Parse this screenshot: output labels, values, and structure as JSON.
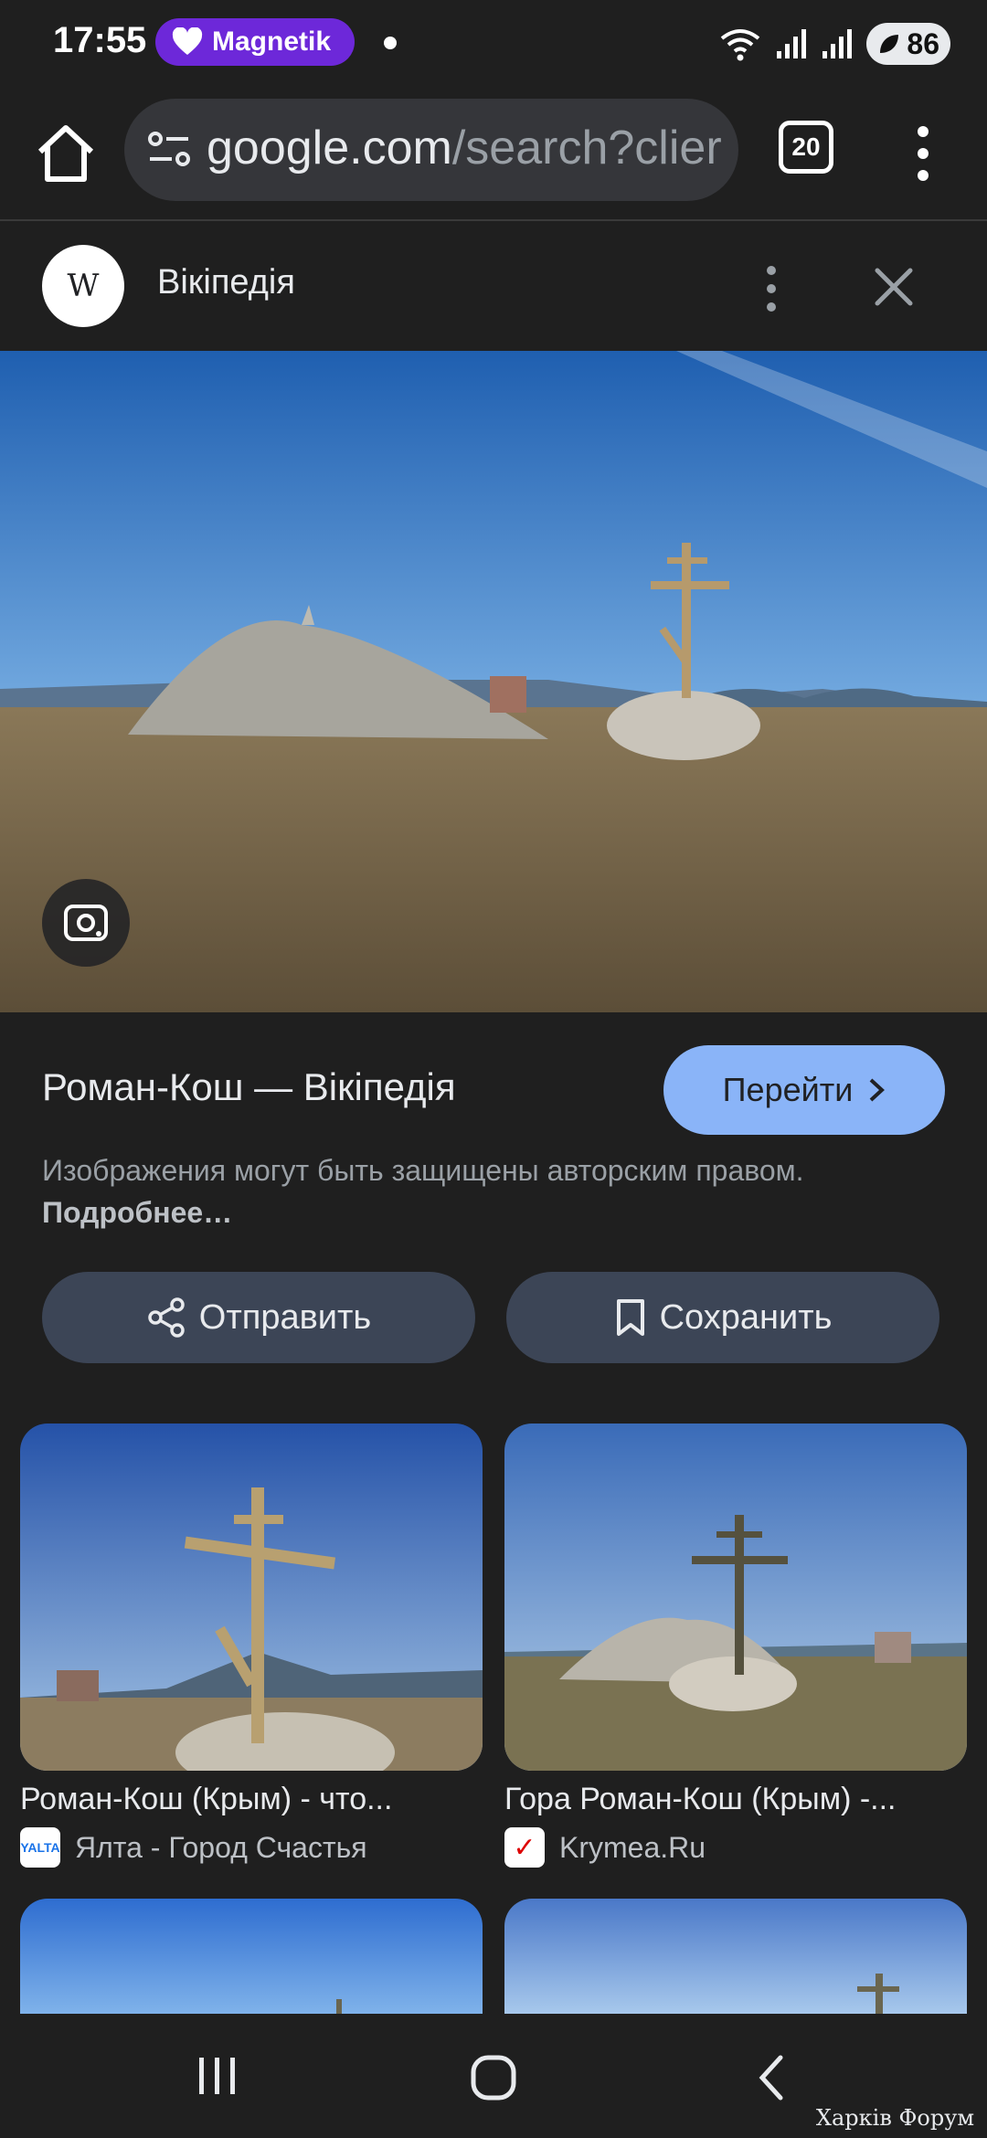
{
  "status_bar": {
    "time": "17:55",
    "notification_app": "Magnetik",
    "battery": "86"
  },
  "browser": {
    "url_host": "google.com",
    "url_rest": "/search?clier",
    "tab_count": "20"
  },
  "source": {
    "logo_text": "W",
    "name": "Вікіпедія"
  },
  "result": {
    "title": "Роман-Кош — Вікіпедія",
    "goto_label": "Перейти",
    "copyright_text": "Изображения могут быть защищены авторским правом.",
    "copyright_link": "Подробнее…"
  },
  "actions": {
    "share_label": "Отправить",
    "save_label": "Сохранить"
  },
  "related": [
    {
      "title": "Роман-Кош (Крым) - что...",
      "source": "Ялта - Город Счастья",
      "favicon_text": "YALTA"
    },
    {
      "title": "Гора Роман-Кош (Крым) -...",
      "source": "Krymea.Ru",
      "favicon_text": "✓"
    }
  ],
  "watermark": "Харків Форум",
  "colors": {
    "background": "#1f1f1f",
    "accent_button": "#8ab4f8",
    "secondary_button": "#3c4556",
    "notification_pill": "#6d28d9"
  }
}
